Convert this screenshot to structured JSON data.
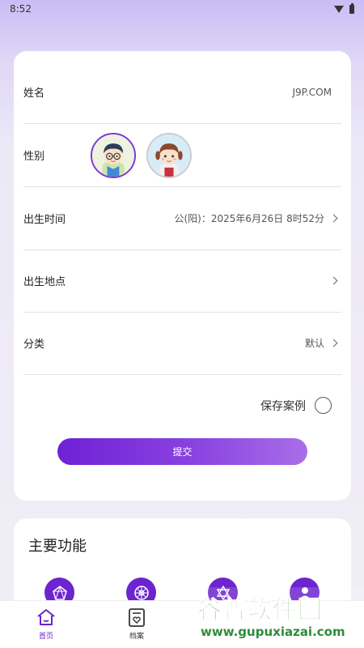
{
  "status_bar": {
    "time": "8:52",
    "icons": [
      "wifi-icon",
      "battery-icon"
    ]
  },
  "form": {
    "name": {
      "label": "姓名",
      "value": "J9P.COM"
    },
    "gender": {
      "label": "性别",
      "options": [
        "male-avatar",
        "female-avatar"
      ],
      "selected": "male-avatar"
    },
    "birth_time": {
      "label": "出生时间",
      "value": "公(阳)：2025年6月26日 8时52分"
    },
    "birth_place": {
      "label": "出生地点",
      "value": ""
    },
    "category": {
      "label": "分类",
      "value": "默认"
    },
    "save_case": {
      "label": "保存案例",
      "checked": false
    },
    "submit_label": "提交"
  },
  "features": {
    "title": "主要功能",
    "icons": [
      "diamond-chart-icon",
      "wheel-icon",
      "star-of-david-icon",
      "person-icon"
    ]
  },
  "tab_bar": {
    "tabs": [
      {
        "label": "首页",
        "icon": "home-icon",
        "active": true
      },
      {
        "label": "档案",
        "icon": "archive-icon",
        "active": false
      }
    ]
  },
  "watermark": {
    "logo": "谷普软件园",
    "url": "www.gupuxiazai.com"
  },
  "colors": {
    "accent": "#6d24cf",
    "button_start": "#6e21d6",
    "button_end": "#a86ee8"
  }
}
